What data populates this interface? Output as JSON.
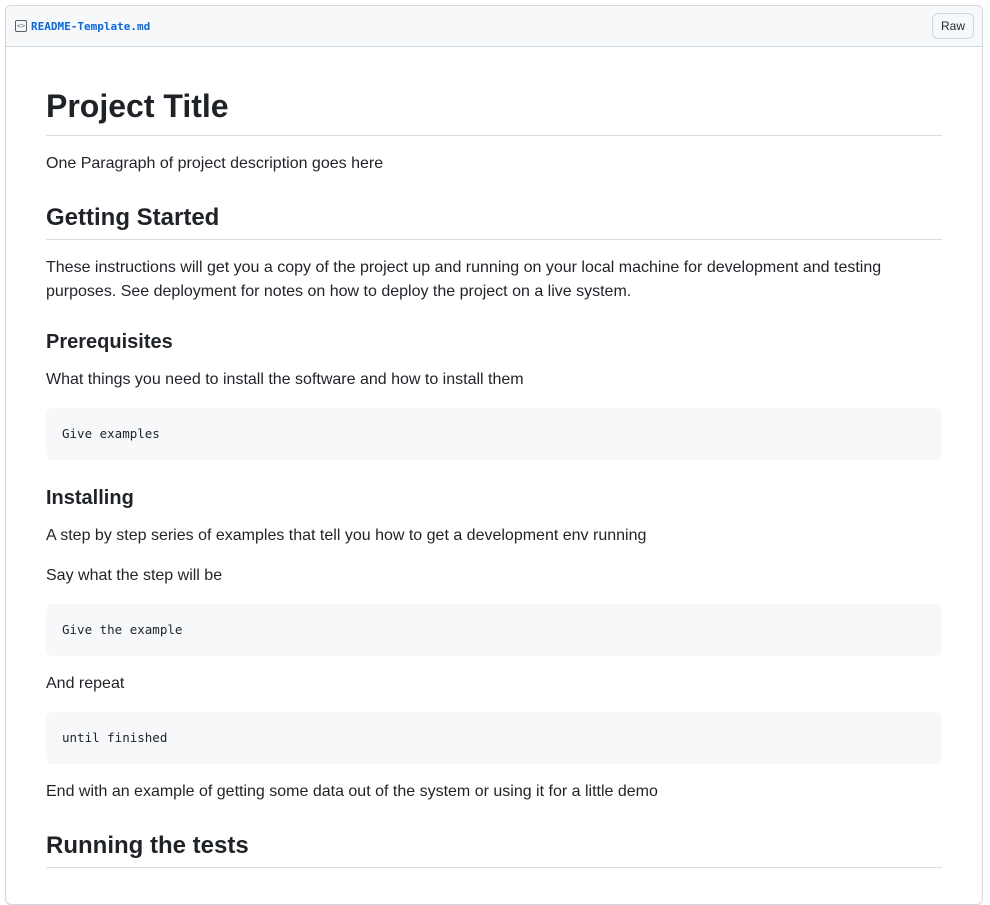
{
  "file": {
    "name": "README-Template.md",
    "raw_label": "Raw",
    "icon": "code-file-icon"
  },
  "doc": {
    "title": "Project Title",
    "intro": "One Paragraph of project description goes here",
    "getting_started": {
      "heading": "Getting Started",
      "text": "These instructions will get you a copy of the project up and running on your local machine for development and testing purposes. See deployment for notes on how to deploy the project on a live system."
    },
    "prerequisites": {
      "heading": "Prerequisites",
      "text": "What things you need to install the software and how to install them",
      "code": "Give examples"
    },
    "installing": {
      "heading": "Installing",
      "text": "A step by step series of examples that tell you how to get a development env running",
      "step_text": "Say what the step will be",
      "code1": "Give the example",
      "repeat_text": "And repeat",
      "code2": "until finished",
      "end_text": "End with an example of getting some data out of the system or using it for a little demo"
    },
    "tests": {
      "heading": "Running the tests"
    }
  }
}
